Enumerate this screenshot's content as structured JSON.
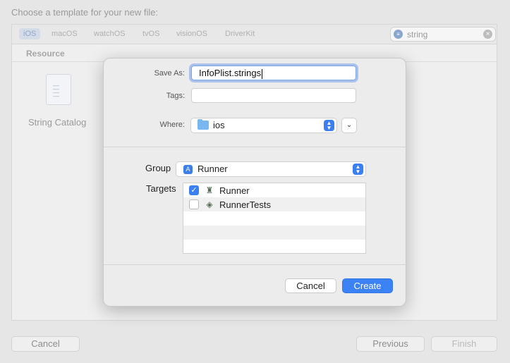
{
  "background": {
    "title": "Choose a template for your new file:",
    "platform_tabs": [
      "iOS",
      "macOS",
      "watchOS",
      "tvOS",
      "visionOS",
      "DriverKit"
    ],
    "search": {
      "value": "string",
      "icon": "filter-icon",
      "clear_icon": "clear-icon"
    },
    "section_header": "Resource",
    "template_item": "String Catalog",
    "buttons": {
      "cancel": "Cancel",
      "previous": "Previous",
      "finish": "Finish"
    }
  },
  "sheet": {
    "save_as_label": "Save As:",
    "save_as_value": "InfoPlist.strings",
    "tags_label": "Tags:",
    "tags_value": "",
    "where_label": "Where:",
    "where_value": "ios",
    "group_label": "Group",
    "group_value": "Runner",
    "targets_label": "Targets",
    "targets": [
      {
        "name": "Runner",
        "checked": true,
        "icon": "app-target-icon"
      },
      {
        "name": "RunnerTests",
        "checked": false,
        "icon": "test-target-icon"
      }
    ],
    "cancel_label": "Cancel",
    "create_label": "Create"
  },
  "colors": {
    "accent": "#3b82f5",
    "focus_ring": "#5a90e6",
    "folder": "#79b7f0"
  }
}
